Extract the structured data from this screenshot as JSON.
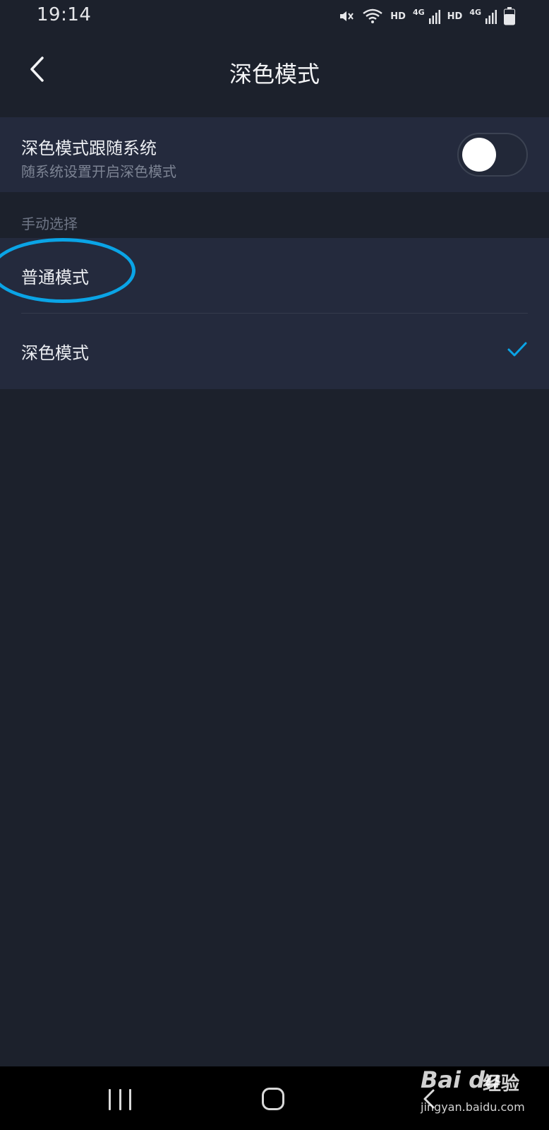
{
  "status_bar": {
    "time": "19:14",
    "icons": [
      "mute-icon",
      "wifi-icon",
      "signal-icon",
      "signal-icon",
      "battery-icon"
    ],
    "hd_labels": [
      "HD",
      "HD"
    ],
    "network_labels": [
      "4G",
      "4G"
    ]
  },
  "header": {
    "title": "深色模式",
    "back_icon": "chevron-left-icon"
  },
  "follow_system": {
    "title": "深色模式跟随系统",
    "subtitle": "随系统设置开启深色模式",
    "enabled": false
  },
  "manual_section": {
    "label": "手动选择",
    "options": [
      {
        "label": "普通模式",
        "selected": false
      },
      {
        "label": "深色模式",
        "selected": true
      }
    ]
  },
  "annotation": {
    "color": "#0aa4e6"
  },
  "colors": {
    "background": "#1c212c",
    "card": "#242a3d",
    "accent": "#0aa4e6"
  },
  "system_nav": {
    "buttons": [
      "recent-apps-icon",
      "home-icon",
      "back-icon"
    ]
  },
  "watermark": {
    "logo_text": "Bai du",
    "brand_cn": "经验",
    "url": "jingyan.baidu.com"
  }
}
